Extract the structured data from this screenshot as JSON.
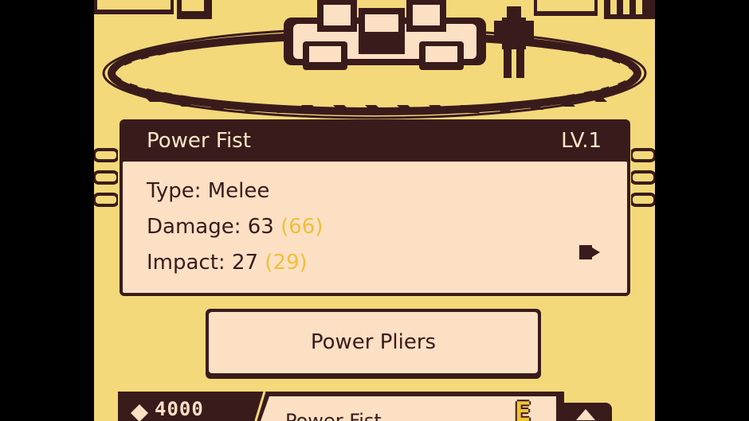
{
  "weapon_info": {
    "name": "Power Fist",
    "level": "LV.1",
    "type_line": "Type: Melee",
    "damage_label": "Damage: 63",
    "damage_upgrade": "(66)",
    "impact_label": "Impact: 27",
    "impact_upgrade": "(29)"
  },
  "weapon_button": {
    "label": "Power Pliers"
  },
  "bottom_bar": {
    "money": "4000",
    "grade": "E",
    "partial_label": "Power Fist"
  },
  "colors": {
    "background": "#f3d97a",
    "dark": "#3a1b1b",
    "cream": "#fbe0c4",
    "highlight": "#f0bf39"
  }
}
